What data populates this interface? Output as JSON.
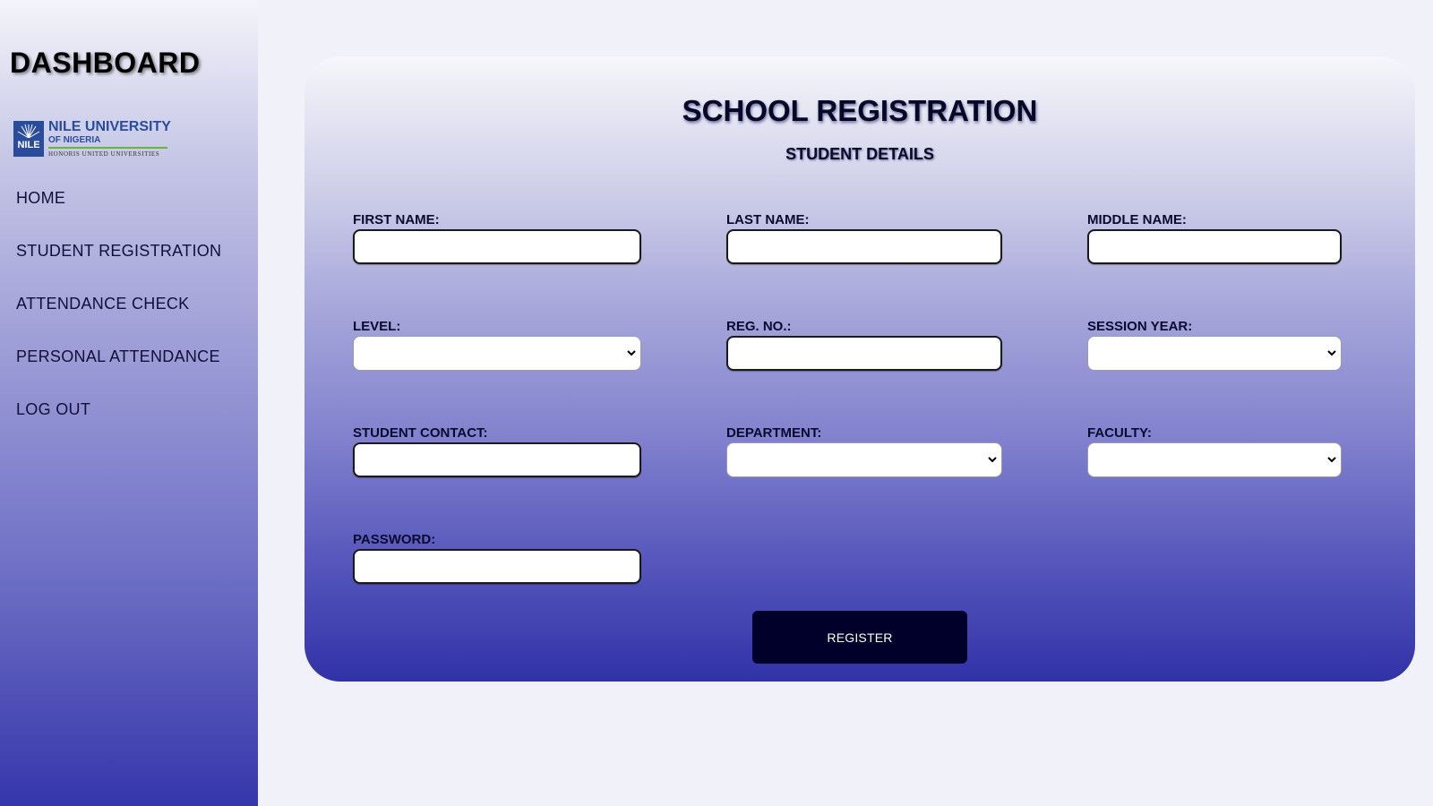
{
  "sidebar": {
    "title": "DASHBOARD",
    "logo": {
      "emblem_text": "NILE",
      "name": "NILE UNIVERSITY",
      "sub": "OF NIGERIA",
      "motto": "HONORIS UNITED UNIVERSITIES"
    },
    "nav": [
      {
        "label": "HOME"
      },
      {
        "label": "STUDENT REGISTRATION"
      },
      {
        "label": "ATTENDANCE CHECK"
      },
      {
        "label": "PERSONAL ATTENDANCE"
      },
      {
        "label": "LOG OUT"
      }
    ]
  },
  "form": {
    "title": "SCHOOL REGISTRATION",
    "subtitle": "STUDENT DETAILS",
    "fields": {
      "first_name": {
        "label": "FIRST NAME:",
        "value": ""
      },
      "last_name": {
        "label": "LAST NAME:",
        "value": ""
      },
      "middle_name": {
        "label": "MIDDLE NAME:",
        "value": ""
      },
      "level": {
        "label": "LEVEL:",
        "selected": ""
      },
      "reg_no": {
        "label": "REG. NO.:",
        "value": ""
      },
      "session_year": {
        "label": "SESSION YEAR:",
        "selected": ""
      },
      "student_contact": {
        "label": "STUDENT CONTACT:",
        "value": ""
      },
      "department": {
        "label": "DEPARTMENT:",
        "selected": ""
      },
      "faculty": {
        "label": "FACULTY:",
        "selected": ""
      },
      "password": {
        "label": "PASSWORD:",
        "value": ""
      }
    },
    "register_label": "REGISTER"
  },
  "colors": {
    "page_bg": "#f1f2f9",
    "gradient_bottom": "#3232a8",
    "button_bg": "#00002a",
    "brand_blue": "#2a4c9c",
    "brand_green": "#6bb33a"
  },
  "icons": {
    "select_arrow": "chevron-down-icon",
    "logo": "nile-university-logo"
  }
}
